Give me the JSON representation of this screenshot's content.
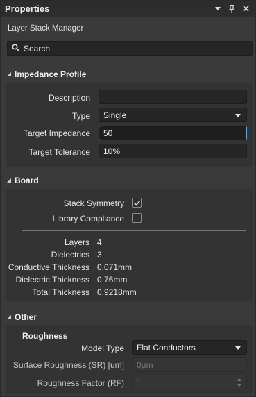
{
  "title": "Properties",
  "subtitle": "Layer Stack Manager",
  "search": {
    "placeholder": "Search"
  },
  "impedance": {
    "header": "Impedance Profile",
    "description_label": "Description",
    "description_value": "",
    "type_label": "Type",
    "type_value": "Single",
    "target_impedance_label": "Target Impedance",
    "target_impedance_value": "50",
    "target_tolerance_label": "Target Tolerance",
    "target_tolerance_value": "10%"
  },
  "board": {
    "header": "Board",
    "stack_symmetry_label": "Stack Symmetry",
    "stack_symmetry_checked": true,
    "library_compliance_label": "Library Compliance",
    "library_compliance_checked": false,
    "stats": [
      {
        "label": "Layers",
        "value": "4"
      },
      {
        "label": "Dielectrics",
        "value": "3"
      },
      {
        "label": "Conductive Thickness",
        "value": "0.071mm"
      },
      {
        "label": "Dielectric Thickness",
        "value": "0.76mm"
      },
      {
        "label": "Total Thickness",
        "value": "0.9218mm"
      }
    ]
  },
  "other": {
    "header": "Other",
    "roughness_title": "Roughness",
    "model_type_label": "Model Type",
    "model_type_value": "Flat Conductors",
    "surface_roughness_label": "Surface Roughness (SR) [um]",
    "surface_roughness_value": "0μm",
    "roughness_factor_label": "Roughness Factor (RF)",
    "roughness_factor_value": "1"
  }
}
